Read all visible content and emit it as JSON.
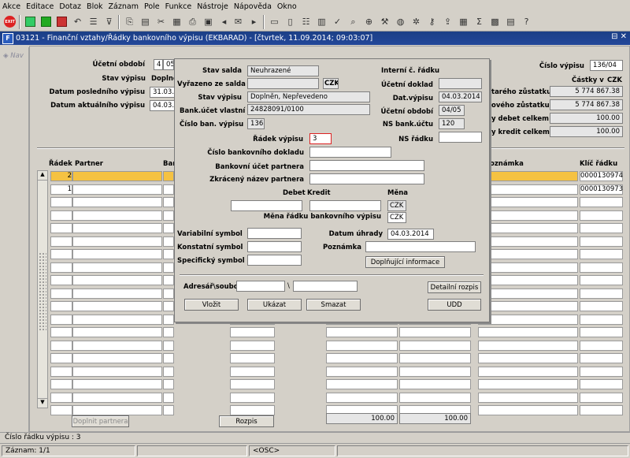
{
  "menu": [
    "Akce",
    "Editace",
    "Dotaz",
    "Blok",
    "Záznam",
    "Pole",
    "Funkce",
    "Nástroje",
    "Nápověda",
    "Okno"
  ],
  "icons": [
    "exit-icon",
    "save-icon",
    "add-icon",
    "delete-icon",
    "filter-icon",
    "copy-icon",
    "paste-icon",
    "print-icon",
    "mail-icon",
    "calc-icon",
    "help-icon"
  ],
  "exit_label": "EXIT",
  "window": {
    "title": "03121 - Finanční vztahy/Řádky bankovního výpisu (EKBARAD) - [čtvrtek, 11.09.2014; 09:03:07]",
    "logo": "F",
    "controls": "⊟ ✕"
  },
  "nav": {
    "label": "Nav"
  },
  "header": {
    "ucetni_obdobi_label": "Účetní období",
    "ucetni_obdobi_a": "4",
    "ucetni_obdobi_b": "05",
    "stav_vypisu_label": "Stav výpisu",
    "stav_vypisu_value": "Doplně",
    "datum_posledniho_label": "Datum posledního výpisu",
    "datum_posledniho_value": "31.03.2",
    "datum_aktualniho_label": "Datum aktuálního výpisu",
    "datum_aktualniho_value": "04.03.2",
    "cislo_vypisu_label": "Číslo výpisu",
    "cislo_vypisu_value": "136/04",
    "castky_label": "Částky v",
    "castky_currency": "CZK",
    "stareho_label": "tarého zůstatku",
    "stareho_value": "5 774 867.38",
    "noveho_label": "ového zůstatku",
    "noveho_value": "5 774 867.38",
    "debet_celkem_label": "y debet celkem",
    "debet_celkem_value": "100.00",
    "kredit_celkem_label": "y kredit celkem",
    "kredit_celkem_value": "100.00"
  },
  "grid": {
    "col_radek": "Řádek",
    "col_partner": "Partner",
    "col_ban": "Ban",
    "col_poznamka": "oznámka",
    "col_klic": "Klíč řádku",
    "rows": [
      {
        "radek": "2",
        "klic": "0000130974"
      },
      {
        "radek": "1",
        "klic": "0000130973"
      }
    ],
    "total_debet": "100.00",
    "total_kredit": "100.00",
    "btn_doplnit": "Doplnit partnera",
    "btn_rozpis": "Rozpis"
  },
  "dialog": {
    "stav_salda_label": "Stav salda",
    "stav_salda_value": "Neuhrazené",
    "vyrazeno_label": "Vyřazeno ze salda",
    "vyrazeno_currency": "CZK",
    "stav_vypisu_label": "Stav výpisu",
    "stav_vypisu_value": "Doplněn, Nepřevedeno",
    "bank_ucet_label": "Bank.účet vlastní",
    "bank_ucet_value": "24828091/0100",
    "cislo_ban_label": "Číslo ban. výpisu",
    "cislo_ban_value": "136",
    "interni_label": "Interní č. řádku",
    "ucetni_doklad_label": "Účetní doklad",
    "dat_vypisu_label": "Dat.výpisu",
    "dat_vypisu_value": "04.03.2014",
    "ucetni_obdobi_label": "Účetní období",
    "ucetni_obdobi_value": "04/05",
    "ns_bank_label": "NS bank.účtu",
    "ns_bank_value": "120",
    "radek_vypisu_label": "Řádek výpisu",
    "radek_vypisu_value": "3",
    "ns_radku_label": "NS řádku",
    "cislo_dokladu_label": "Číslo bankovního dokladu",
    "bank_ucet_partnera_label": "Bankovní účet partnera",
    "zkraceny_nazev_label": "Zkrácený název partnera",
    "debet_label": "Debet",
    "kredit_label": "Kredit",
    "mena_label": "Měna",
    "mena_value": "CZK",
    "mena_radku_label": "Měna řádku bankovního výpisu",
    "mena_radku_value": "CZK",
    "variabilni_label": "Variabilní symbol",
    "konstantni_label": "Konstatní symbol",
    "specificky_label": "Specifický symbol",
    "datum_uhrady_label": "Datum úhrady",
    "datum_uhrady_value": "04.03.2014",
    "poznamka_label": "Poznámka",
    "btn_doplnujici": "Doplňující informace",
    "adresar_label": "Adresář\\soubor",
    "adresar_sep": "\\",
    "btn_detailni": "Detailní rozpis",
    "btn_vlozit": "Vložit",
    "btn_ukazat": "Ukázat",
    "btn_smazat": "Smazat",
    "btn_udd": "UDD"
  },
  "status": {
    "line1": "Číslo řádku výpisu : 3",
    "zaznam": "Záznam: 1/1",
    "osc": "<OSC>"
  }
}
